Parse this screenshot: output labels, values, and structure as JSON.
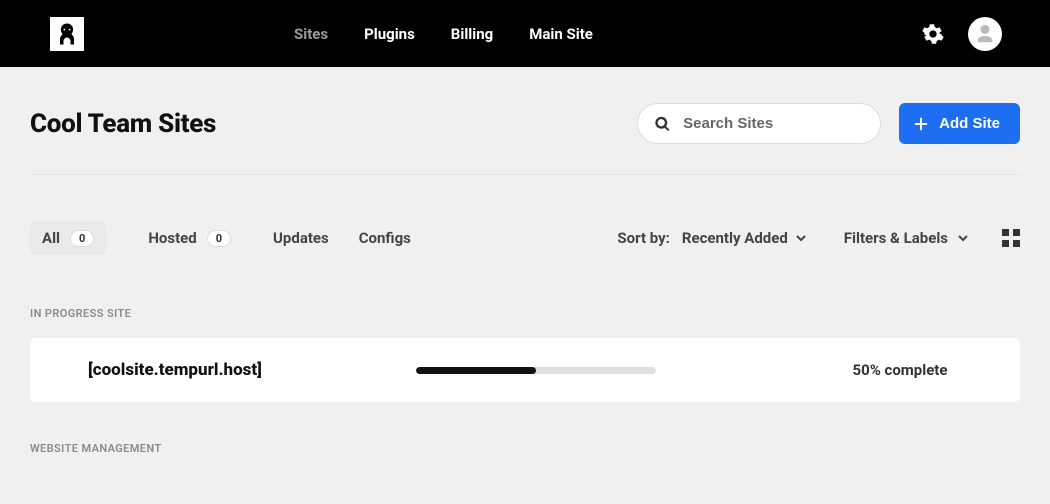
{
  "nav": {
    "items": [
      "Sites",
      "Plugins",
      "Billing",
      "Main Site"
    ],
    "active_index": 0
  },
  "page": {
    "title": "Cool Team Sites"
  },
  "search": {
    "placeholder": "Search Sites"
  },
  "add_button": {
    "label": "Add Site"
  },
  "tabs": {
    "items": [
      {
        "label": "All",
        "count": "0",
        "active": true
      },
      {
        "label": "Hosted",
        "count": "0",
        "active": false
      },
      {
        "label": "Updates",
        "count": null,
        "active": false
      },
      {
        "label": "Configs",
        "count": null,
        "active": false
      }
    ]
  },
  "sort": {
    "label": "Sort by:",
    "value": "Recently Added"
  },
  "filters": {
    "label": "Filters & Labels"
  },
  "sections": {
    "in_progress_label": "IN PROGRESS SITE",
    "management_label": "WEBSITE MANAGEMENT"
  },
  "site": {
    "name": "[coolsite.tempurl.host]",
    "progress_percent": 50,
    "progress_label": "50% complete"
  }
}
